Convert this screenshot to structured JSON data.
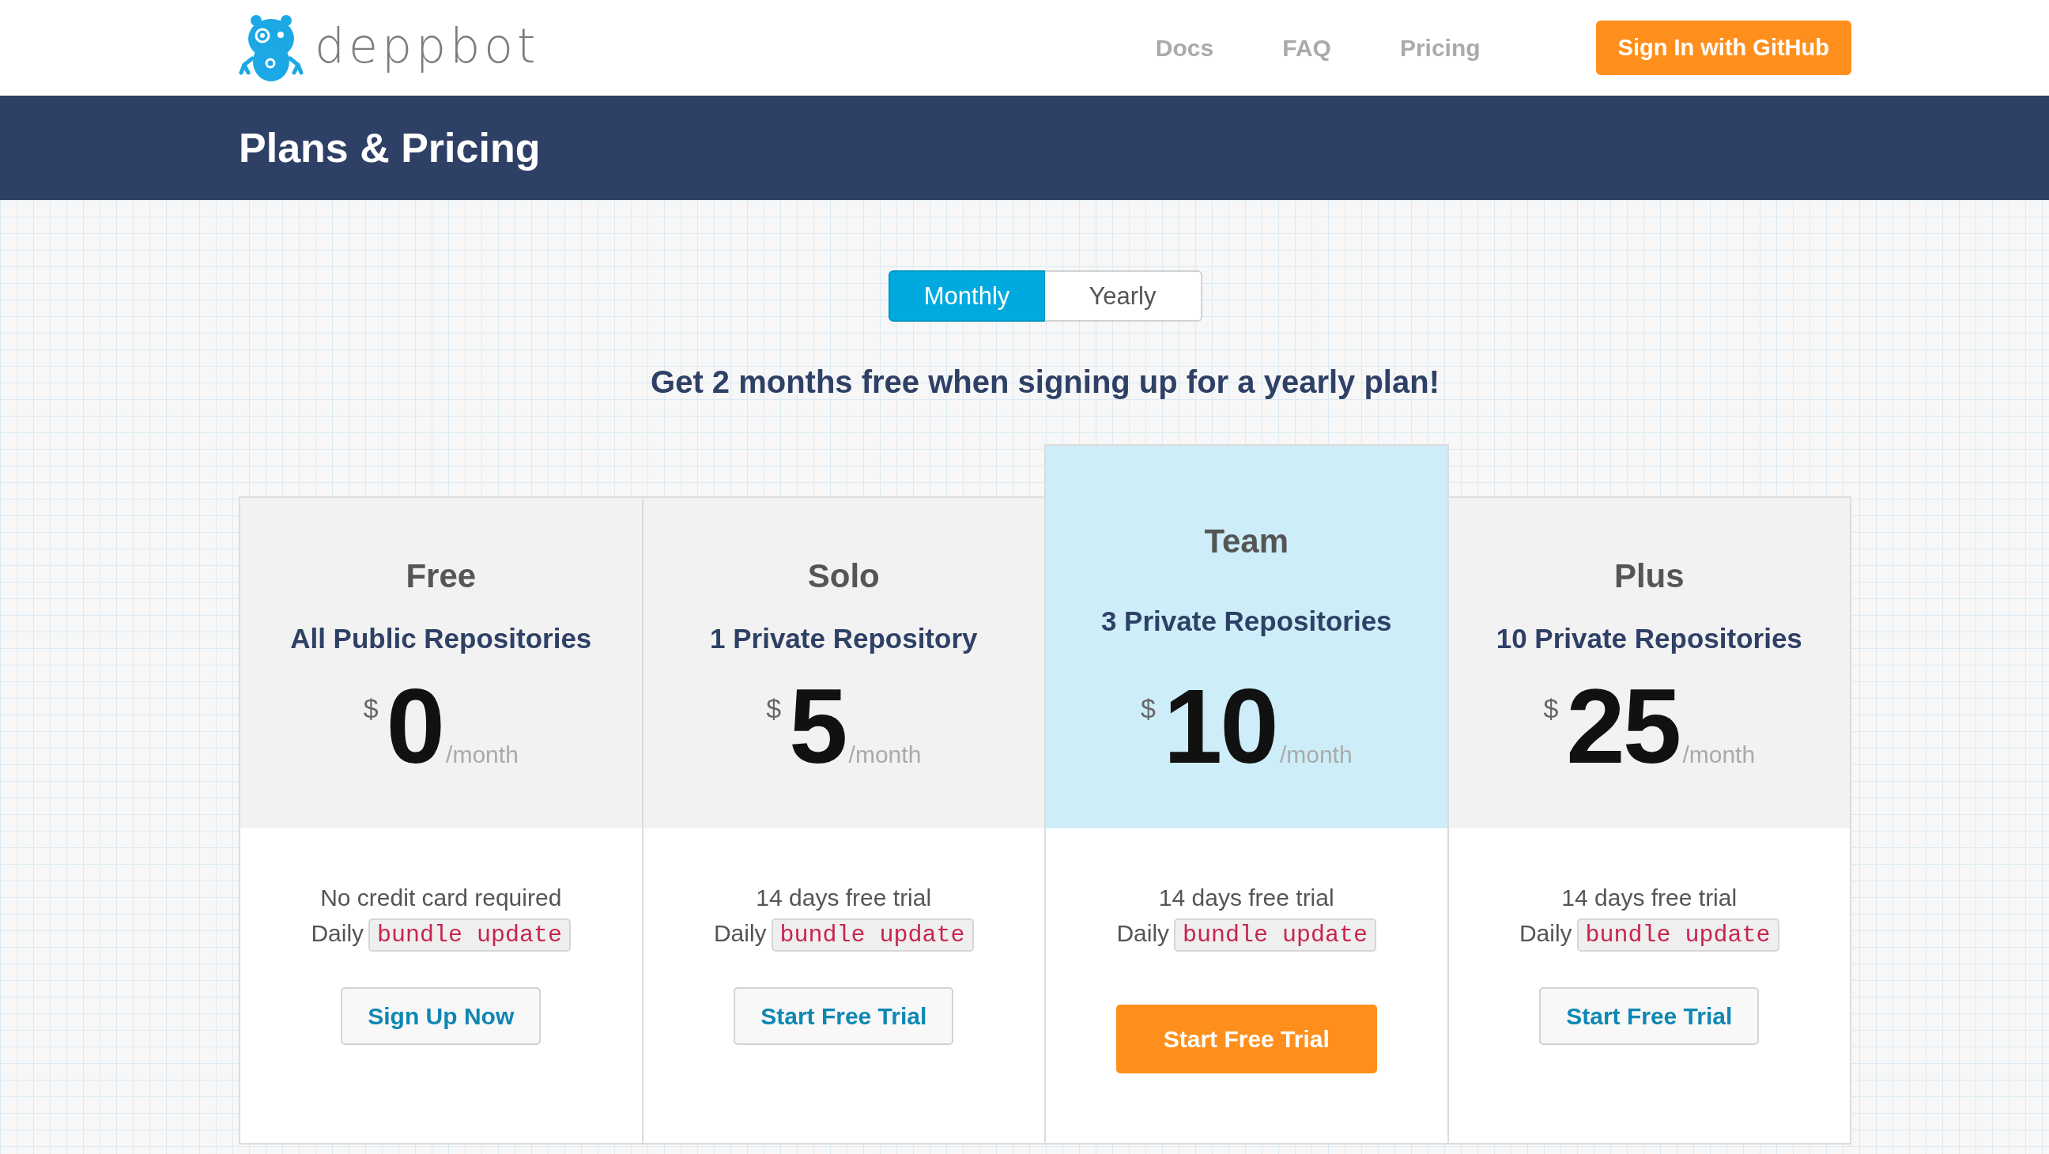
{
  "header": {
    "brand": "deppbot",
    "nav": [
      {
        "label": "Docs"
      },
      {
        "label": "FAQ"
      },
      {
        "label": "Pricing"
      }
    ],
    "sign_in_button": "Sign In with GitHub"
  },
  "banner": {
    "title": "Plans & Pricing"
  },
  "billing_toggle": [
    {
      "label": "Monthly",
      "selected": true
    },
    {
      "label": "Yearly",
      "selected": false
    }
  ],
  "promo": "Get 2 months free when signing up for a yearly plan!",
  "plans": [
    {
      "name": "Free",
      "repositories": "All Public Repositories",
      "currency": "$",
      "price": "0",
      "period": "/month",
      "note": "No credit card required",
      "feature": {
        "label": "Daily",
        "code": "bundle update"
      },
      "button": "Sign Up Now",
      "featured": false
    },
    {
      "name": "Solo",
      "repositories": "1 Private Repository",
      "currency": "$",
      "price": "5",
      "period": "/month",
      "note": "14 days free trial",
      "feature": {
        "label": "Daily",
        "code": "bundle update"
      },
      "button": "Start Free Trial",
      "featured": false
    },
    {
      "name": "Team",
      "repositories": "3 Private Repositories",
      "currency": "$",
      "price": "10",
      "period": "/month",
      "note": "14 days free trial",
      "feature": {
        "label": "Daily",
        "code": "bundle update"
      },
      "button": "Start Free Trial",
      "featured": true
    },
    {
      "name": "Plus",
      "repositories": "10 Private Repositories",
      "currency": "$",
      "price": "25",
      "period": "/month",
      "note": "14 days free trial",
      "feature": {
        "label": "Daily",
        "code": "bundle update"
      },
      "button": "Start Free Trial",
      "featured": false
    }
  ]
}
